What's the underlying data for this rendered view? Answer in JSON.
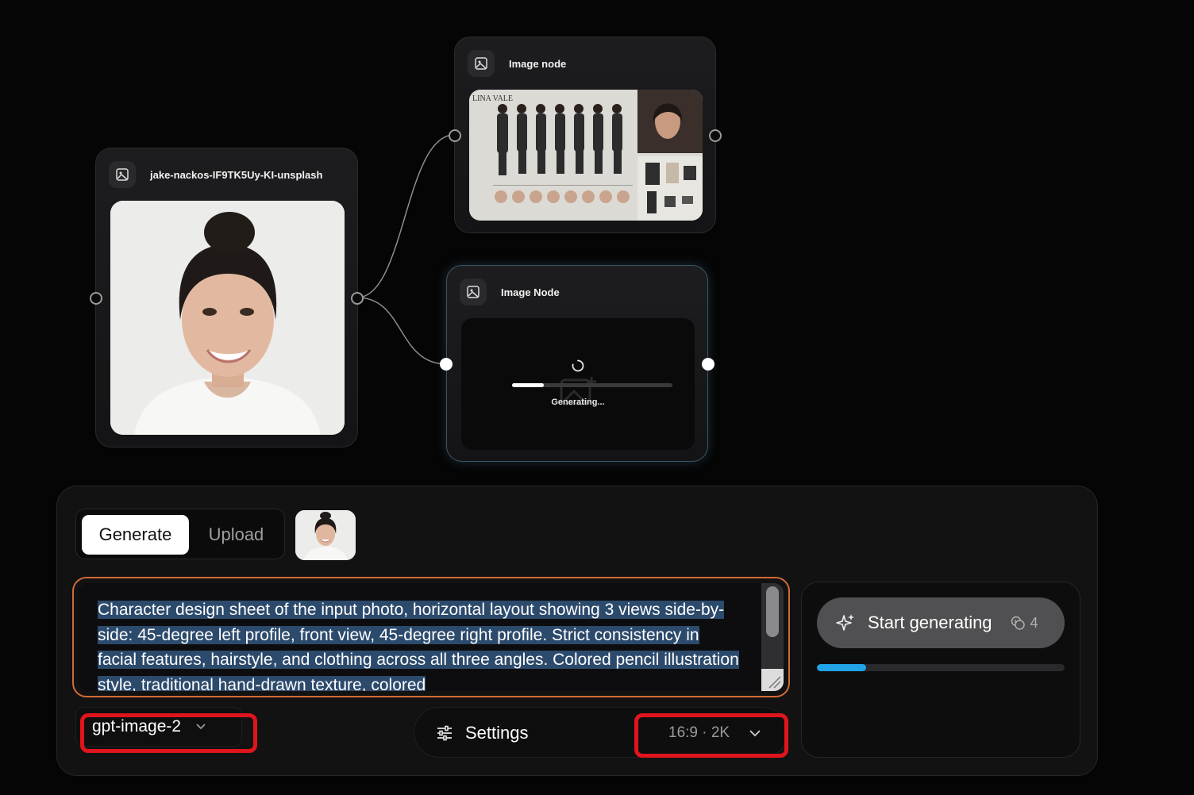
{
  "canvas": {
    "nodes": {
      "source": {
        "title": "jake-nackos-IF9TK5Uy-KI-unsplash",
        "icon": "image-icon"
      },
      "result": {
        "title": "Image node",
        "icon": "image-icon",
        "sheet_label": "LINA VALE"
      },
      "generating": {
        "title": "Image Node",
        "icon": "image-icon",
        "status": "Generating...",
        "progress": 0.2
      }
    }
  },
  "panel": {
    "tabs": [
      {
        "label": "Generate",
        "active": true
      },
      {
        "label": "Upload",
        "active": false
      }
    ],
    "prompt": "Character design sheet of the input photo, horizontal layout showing 3 views side-by-side: 45-degree left profile, front view, 45-degree right profile. Strict consistency in facial features, hairstyle, and clothing across all three angles. Colored pencil illustration style, traditional hand-drawn texture, colored",
    "model": {
      "value": "gpt-image-2",
      "icon": "chevron-down-icon"
    },
    "settings": {
      "label": "Settings",
      "icon": "sliders-icon"
    },
    "aspect": {
      "value": "16:9 · 2K",
      "icon": "chevron-down-icon"
    },
    "start_button": {
      "label": "Start generating",
      "credits": "4",
      "icon": "sparkles-icon",
      "credits_icon": "coins-icon"
    },
    "progress": 0.2
  },
  "colors": {
    "highlight_outline": "#e0141c",
    "prompt_focus_border": "#d26a35",
    "progress_accent": "#21a4e6",
    "selection": "#2c4a6c"
  }
}
